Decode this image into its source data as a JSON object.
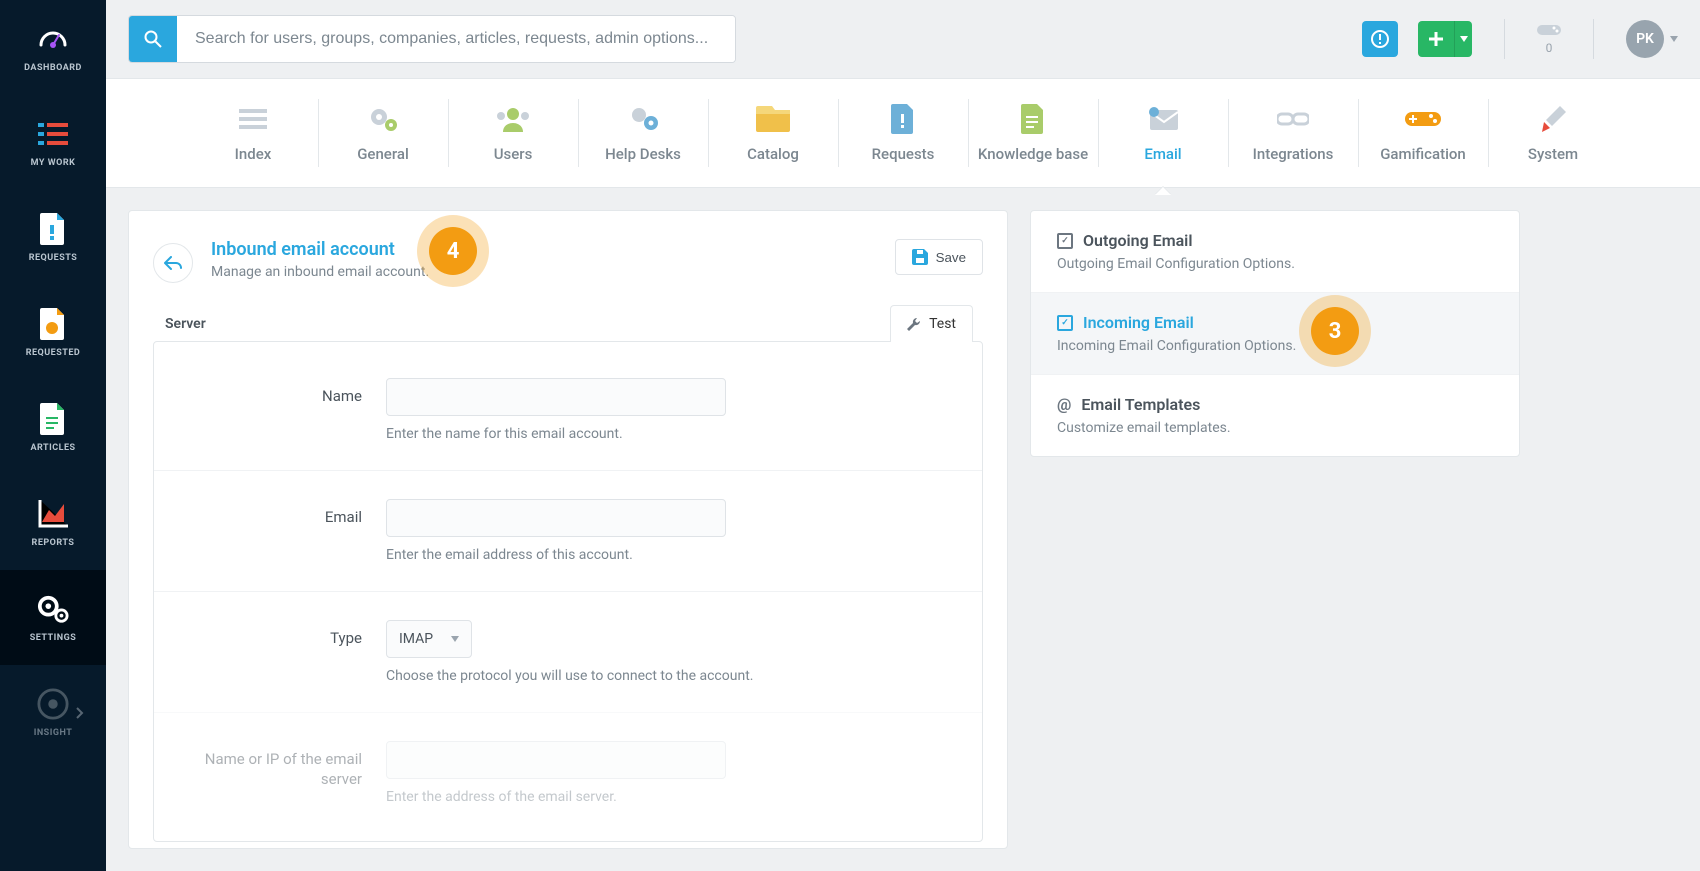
{
  "leftnav": {
    "items": [
      {
        "label": "DASHBOARD"
      },
      {
        "label": "MY WORK"
      },
      {
        "label": "REQUESTS"
      },
      {
        "label": "REQUESTED"
      },
      {
        "label": "ARTICLES"
      },
      {
        "label": "REPORTS"
      },
      {
        "label": "SETTINGS"
      },
      {
        "label": "INSIGHT"
      }
    ]
  },
  "topbar": {
    "search_placeholder": "Search for users, groups, companies, articles, requests, admin options...",
    "gami_count": "0",
    "avatar_initials": "PK"
  },
  "tabs": [
    {
      "label": "Index"
    },
    {
      "label": "General"
    },
    {
      "label": "Users"
    },
    {
      "label": "Help Desks"
    },
    {
      "label": "Catalog"
    },
    {
      "label": "Requests"
    },
    {
      "label": "Knowledge base"
    },
    {
      "label": "Email"
    },
    {
      "label": "Integrations"
    },
    {
      "label": "Gamification"
    },
    {
      "label": "System"
    }
  ],
  "main": {
    "back_icon": "↩",
    "title": "Inbound email account",
    "subtitle": "Manage an inbound email account.",
    "save_label": "Save",
    "inner": {
      "server_tab": "Server",
      "test_tab": "Test"
    },
    "fields": {
      "name": {
        "label": "Name",
        "hint": "Enter the name for this email account."
      },
      "email": {
        "label": "Email",
        "hint": "Enter the email address of this account."
      },
      "type": {
        "label": "Type",
        "value": "IMAP",
        "hint": "Choose the protocol you will use to connect to the account."
      },
      "server": {
        "label": "Name or IP of the email server",
        "hint": "Enter the address of the email server."
      }
    }
  },
  "side": {
    "items": [
      {
        "title": "Outgoing Email",
        "desc": "Outgoing Email Configuration Options."
      },
      {
        "title": "Incoming Email",
        "desc": "Incoming Email Configuration Options."
      },
      {
        "title": "Email Templates",
        "desc": "Customize email templates."
      }
    ]
  },
  "steps": {
    "four": "4",
    "three": "3"
  }
}
